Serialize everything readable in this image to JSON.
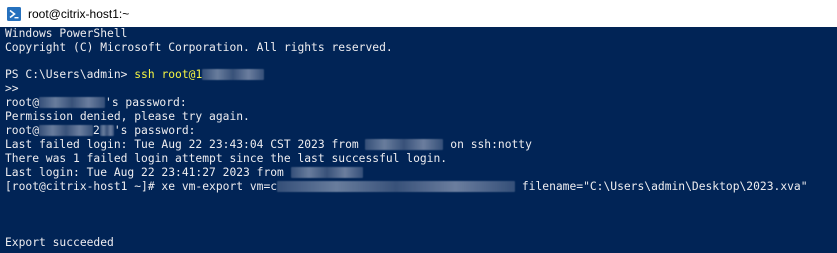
{
  "window": {
    "title": "root@citrix-host1:~",
    "icon": "powershell-icon"
  },
  "terminal": {
    "background": "#012456",
    "foreground": "#eeedf0",
    "prompt_color": "#f5f543",
    "lines": {
      "banner1": "Windows PowerShell",
      "banner2": "Copyright (C) Microsoft Corporation. All rights reserved.",
      "ps_prompt": "PS C:\\Users\\admin> ",
      "ssh_cmd": "ssh root@1",
      "continuation": ">>",
      "pw1_user": "root@",
      "pw1_tail": "'s password:",
      "denied": "Permission denied, please try again.",
      "pw2_user": "root@",
      "pw2_mid": "2",
      "pw2_tail": "'s password:",
      "last_failed_a": "Last failed login: Tue Aug 22 23:43:04 CST 2023 from ",
      "last_failed_b": " on ssh:notty",
      "failed_attempts": "There was 1 failed login attempt since the last successful login.",
      "last_login": "Last login: Tue Aug 22 23:41:27 2023 from ",
      "export_cmd_a": "[root@citrix-host1 ~]# xe vm-export vm=c",
      "export_cmd_b": " filename=\"C:\\Users\\admin\\Desktop\\2023.xva\"",
      "export_result": "Export succeeded"
    }
  }
}
